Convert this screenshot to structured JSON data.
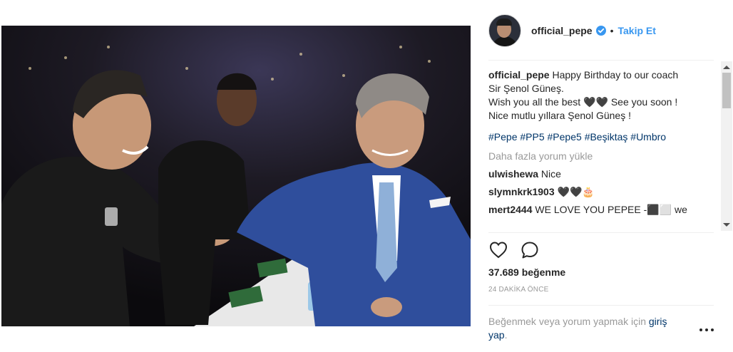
{
  "post": {
    "username": "official_pepe",
    "follow_label": "Takip Et",
    "separator": "•"
  },
  "caption": {
    "username": "official_pepe",
    "line1": "Happy Birthday to our coach",
    "line2": "Sir Şenol Güneş.",
    "line3": "Wish you all the best 🖤🖤 See you soon !",
    "line4": "Nice mutlu yıllara Şenol Güneş !",
    "hashtags": [
      "#Pepe",
      "#PP5",
      "#Pepe5",
      "#Beşiktaş",
      "#Umbro"
    ]
  },
  "load_more_label": "Daha fazla yorum yükle",
  "comments": [
    {
      "user": "ulwishewa",
      "text": "Nice"
    },
    {
      "user": "slymnkrk1903",
      "text": "🖤🖤🎂"
    },
    {
      "user": "mert2444",
      "text": "WE LOVE YOU PEPEE -⬛⬜ we"
    }
  ],
  "likes_label": "37.689 beğenme",
  "time_label": "24 DAKİKA ÖNCE",
  "login_prompt": {
    "prefix": "Beğenmek veya yorum yapmak için ",
    "link": "giriş yap",
    "suffix": "."
  },
  "icons": {
    "like": "heart-icon",
    "comment": "comment-icon",
    "verified": "verified-badge-icon",
    "more": "more-options-icon"
  },
  "colors": {
    "accent": "#3897f0",
    "hashtag": "#003569",
    "muted": "#999999"
  }
}
